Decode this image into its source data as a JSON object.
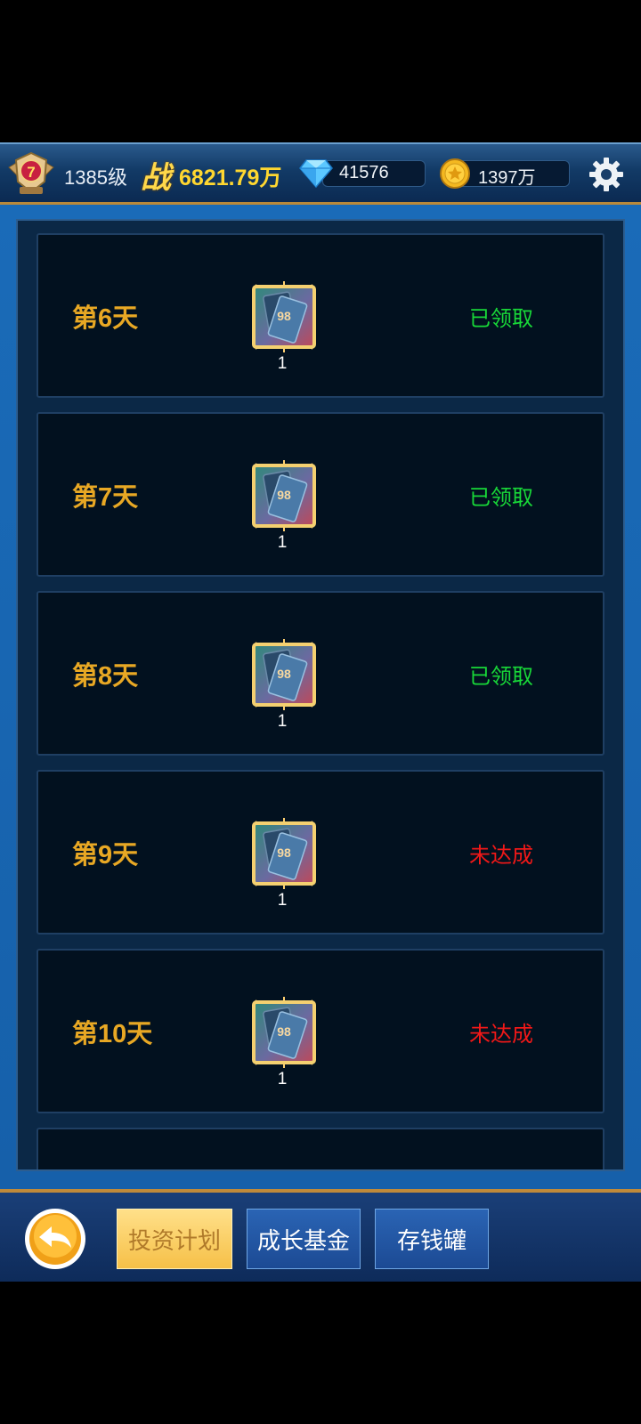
{
  "header": {
    "rank_badge_number": "7",
    "level": "1385级",
    "power_icon_char": "战",
    "power_value": "6821.79万",
    "diamonds": "41576",
    "gold": "1397万"
  },
  "rewards": [
    {
      "day": "第6天",
      "item_label": "98",
      "quantity": "1",
      "status": "已领取",
      "state": "claimed"
    },
    {
      "day": "第7天",
      "item_label": "98",
      "quantity": "1",
      "status": "已领取",
      "state": "claimed"
    },
    {
      "day": "第8天",
      "item_label": "98",
      "quantity": "1",
      "status": "已领取",
      "state": "claimed"
    },
    {
      "day": "第9天",
      "item_label": "98",
      "quantity": "1",
      "status": "未达成",
      "state": "locked"
    },
    {
      "day": "第10天",
      "item_label": "98",
      "quantity": "1",
      "status": "未达成",
      "state": "locked"
    }
  ],
  "tabs": {
    "invest_plan": "投资计划",
    "growth_fund": "成长基金",
    "piggy_bank": "存钱罐"
  },
  "icons": [
    "rank-badge-icon",
    "diamond-icon",
    "gold-coin-icon",
    "settings-gear-icon",
    "card-pack-icon",
    "back-arrow-icon"
  ],
  "colors": {
    "claimed": "#18d838",
    "locked": "#f01818",
    "day_label": "#e8a824",
    "power": "#ffd730"
  }
}
